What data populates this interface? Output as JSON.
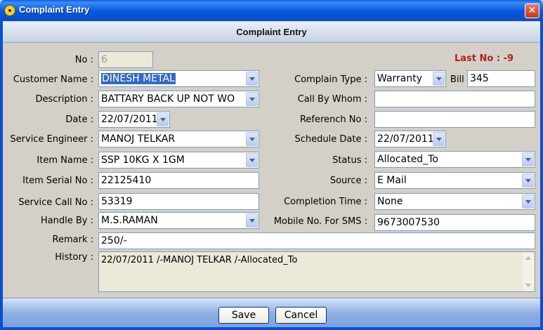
{
  "window": {
    "title": "Complaint Entry",
    "close_glyph": "✕",
    "app_icon": "radiation-icon"
  },
  "header": {
    "title": "Complaint Entry"
  },
  "last_no": "Last No : -9",
  "labels": {
    "no": "No :",
    "customer_name": "Customer Name :",
    "description": "Description :",
    "date": "Date :",
    "service_engineer": "Service Engineer :",
    "item_name": "Item Name :",
    "item_serial_no": "Item Serial No :",
    "service_call_no": "Service Call No :",
    "handle_by": "Handle By :",
    "remark": "Remark :",
    "history": "History :",
    "complain_type": "Complain Type :",
    "bill": "Bill",
    "call_by_whom": "Call By Whom :",
    "referench_no": "Referench No :",
    "schedule_date": "Schedule Date :",
    "status": "Status :",
    "source": "Source :",
    "completion_time": "Completion Time :",
    "mobile_sms": "Mobile No. For SMS :"
  },
  "values": {
    "no": "6",
    "customer_name": "DINESH METAL",
    "description": "BATTARY BACK UP NOT WO",
    "date": "22/07/2011",
    "service_engineer": "MANOJ TELKAR",
    "item_name": "SSP 10KG X 1GM",
    "item_serial_no": "22125410",
    "service_call_no": "53319",
    "handle_by": "M.S.RAMAN",
    "remark": "250/-",
    "history": "22/07/2011 /-MANOJ TELKAR /-Allocated_To",
    "complain_type": "Warranty",
    "bill": "345",
    "call_by_whom": "",
    "referench_no": "",
    "schedule_date": "22/07/2011",
    "status": "Allocated_To",
    "source": "E Mail",
    "completion_time": "None",
    "mobile_sms": "9673007530"
  },
  "buttons": {
    "save": "Save",
    "cancel": "Cancel"
  }
}
